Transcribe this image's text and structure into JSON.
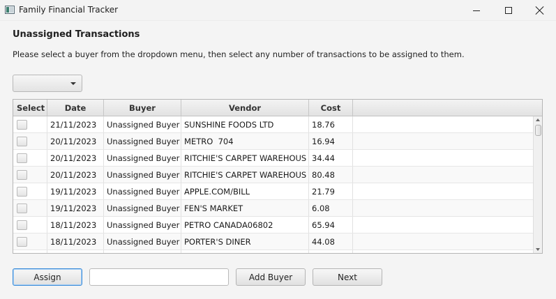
{
  "window": {
    "title": "Family Financial Tracker"
  },
  "page": {
    "heading": "Unassigned Transactions",
    "instructions": "Please select a buyer from the dropdown menu, then select any number of transactions to be assigned to them."
  },
  "buyer_select": {
    "selected": ""
  },
  "table": {
    "columns": [
      "Select",
      "Date",
      "Buyer",
      "Vendor",
      "Cost"
    ],
    "rows": [
      {
        "date": "21/11/2023",
        "buyer": "Unassigned Buyer",
        "vendor": "SUNSHINE FOODS LTD",
        "cost": "18.76"
      },
      {
        "date": "20/11/2023",
        "buyer": "Unassigned Buyer",
        "vendor": "METRO  704",
        "cost": "16.94"
      },
      {
        "date": "20/11/2023",
        "buyer": "Unassigned Buyer",
        "vendor": "RITCHIE'S CARPET WAREHOUS",
        "cost": "34.44"
      },
      {
        "date": "20/11/2023",
        "buyer": "Unassigned Buyer",
        "vendor": "RITCHIE'S CARPET WAREHOUS",
        "cost": "80.48"
      },
      {
        "date": "19/11/2023",
        "buyer": "Unassigned Buyer",
        "vendor": "APPLE.COM/BILL",
        "cost": "21.79"
      },
      {
        "date": "19/11/2023",
        "buyer": "Unassigned Buyer",
        "vendor": "FEN'S MARKET",
        "cost": "6.08"
      },
      {
        "date": "18/11/2023",
        "buyer": "Unassigned Buyer",
        "vendor": "PETRO CANADA06802",
        "cost": "65.94"
      },
      {
        "date": "18/11/2023",
        "buyer": "Unassigned Buyer",
        "vendor": "PORTER'S DINER",
        "cost": "44.08"
      }
    ]
  },
  "footer": {
    "assign_label": "Assign",
    "new_buyer_value": "",
    "add_buyer_label": "Add Buyer",
    "next_label": "Next"
  }
}
